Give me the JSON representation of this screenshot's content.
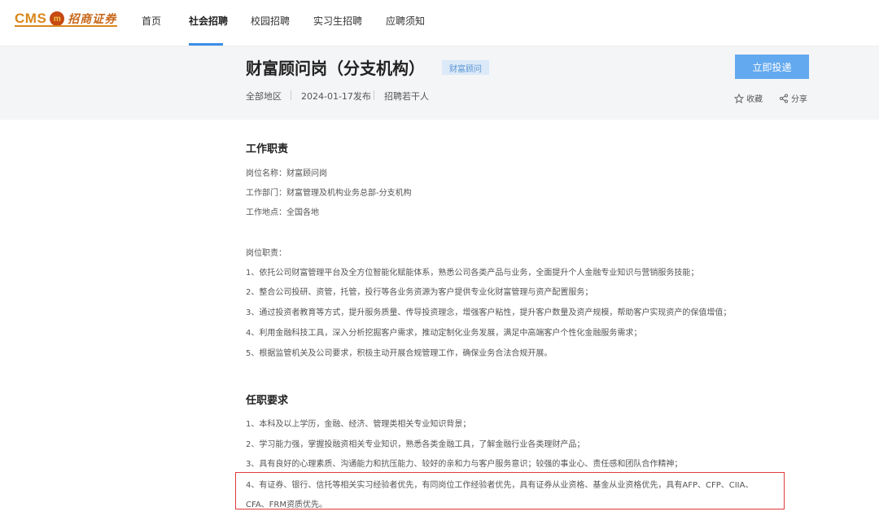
{
  "logo": {
    "brand": "CMS",
    "badge": "m",
    "cn": "招商证券"
  },
  "nav": {
    "items": [
      "首页",
      "社会招聘",
      "校园招聘",
      "实习生招聘",
      "应聘须知"
    ],
    "active_index": 1
  },
  "job": {
    "title": "财富顾问岗（分支机构）",
    "tag": "财富顾问",
    "location": "全部地区",
    "date": "2024-01-17发布",
    "headcount": "招聘若干人",
    "apply_label": "立即投递",
    "favorite_label": "收藏",
    "share_label": "分享"
  },
  "duties": {
    "heading": "工作职责",
    "info": [
      "岗位名称：财富顾问岗",
      "工作部门：财富管理及机构业务总部-分支机构",
      "工作地点：全国各地"
    ],
    "subheading": "岗位职责：",
    "items": [
      "1、依托公司财富管理平台及全方位智能化赋能体系，熟悉公司各类产品与业务，全面提升个人金融专业知识与营销服务技能；",
      "2、整合公司投研、资管，托管，投行等各业务资源为客户提供专业化财富管理与资产配置服务；",
      "3、通过投资者教育等方式，提升服务质量、传导投资理念，增强客户粘性，提升客户数量及资产规模，帮助客户实现资产的保值增值；",
      "4、利用金融科技工具，深入分析挖掘客户需求，推动定制化业务发展，满足中高端客户个性化金融服务需求；",
      "5、根据监管机关及公司要求，积极主动开展合规管理工作，确保业务合法合规开展。"
    ]
  },
  "requirements": {
    "heading": "任职要求",
    "items": [
      "1、本科及以上学历，金融、经济、管理类相关专业知识背景；",
      "2、学习能力强，掌握投融资相关专业知识，熟悉各类金融工具，了解金融行业各类理财产品；",
      "3、具有良好的心理素质、沟通能力和抗压能力、较好的亲和力与客户服务意识；较强的事业心、责任感和团队合作精神；",
      "4、有证券、银行、信托等相关实习经验者优先，有同岗位工作经验者优先，具有证券从业资格、基金从业资格优先，具有AFP、CFP、CIIA、",
      "CFA、FRM资质优先。"
    ]
  },
  "colors": {
    "brand": "#d9871a",
    "accent": "#3a8ee6",
    "button": "#63a9ef",
    "highlight": "#e03a3a"
  }
}
